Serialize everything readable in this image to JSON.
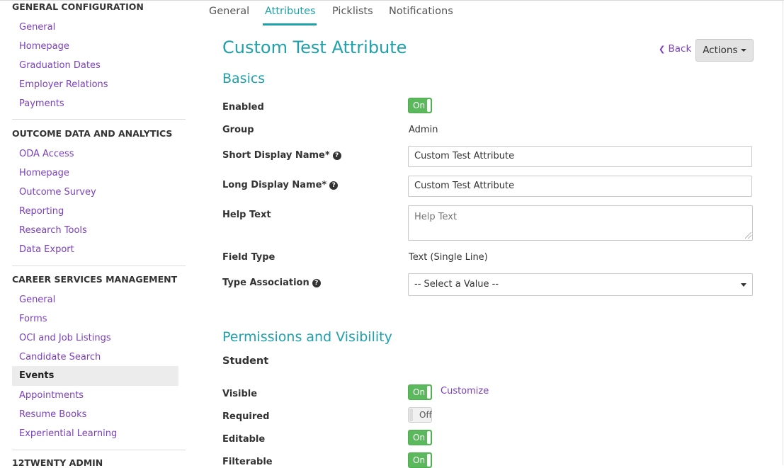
{
  "sidebar": {
    "sections": [
      {
        "heading": "GENERAL CONFIGURATION",
        "items": [
          "General",
          "Homepage",
          "Graduation Dates",
          "Employer Relations",
          "Payments"
        ]
      },
      {
        "heading": "OUTCOME DATA AND ANALYTICS",
        "items": [
          "ODA Access",
          "Homepage",
          "Outcome Survey",
          "Reporting",
          "Research Tools",
          "Data Export"
        ]
      },
      {
        "heading": "CAREER SERVICES MANAGEMENT",
        "items": [
          "General",
          "Forms",
          "OCI and Job Listings",
          "Candidate Search",
          "Events",
          "Appointments",
          "Resume Books",
          "Experiential Learning"
        ],
        "active": "Events"
      },
      {
        "heading": "12TWENTY ADMIN",
        "items": []
      }
    ]
  },
  "tabs": {
    "items": [
      "General",
      "Attributes",
      "Picklists",
      "Notifications"
    ],
    "active": "Attributes"
  },
  "page": {
    "title": "Custom Test Attribute",
    "back_label": "Back",
    "actions_label": "Actions"
  },
  "basics": {
    "heading": "Basics",
    "enabled_label": "Enabled",
    "enabled_toggle": "On",
    "group_label": "Group",
    "group_value": "Admin",
    "short_name_label": "Short Display Name*",
    "short_name_value": "Custom Test Attribute",
    "long_name_label": "Long Display Name*",
    "long_name_value": "Custom Test Attribute",
    "help_text_label": "Help Text",
    "help_text_placeholder": "Help Text",
    "field_type_label": "Field Type",
    "field_type_value": "Text (Single Line)",
    "type_assoc_label": "Type Association",
    "type_assoc_value": "-- Select a Value --"
  },
  "permissions": {
    "heading": "Permissions and Visibility",
    "subheading": "Student",
    "visible_label": "Visible",
    "visible_toggle": "On",
    "customize_label": "Customize",
    "required_label": "Required",
    "required_toggle": "Off",
    "editable_label": "Editable",
    "editable_toggle": "On",
    "filterable_label": "Filterable",
    "filterable_toggle": "On"
  },
  "colors": {
    "accent": "#1fa1ab",
    "link": "#7b3fbf",
    "toggle_on": "#5cb85c"
  }
}
